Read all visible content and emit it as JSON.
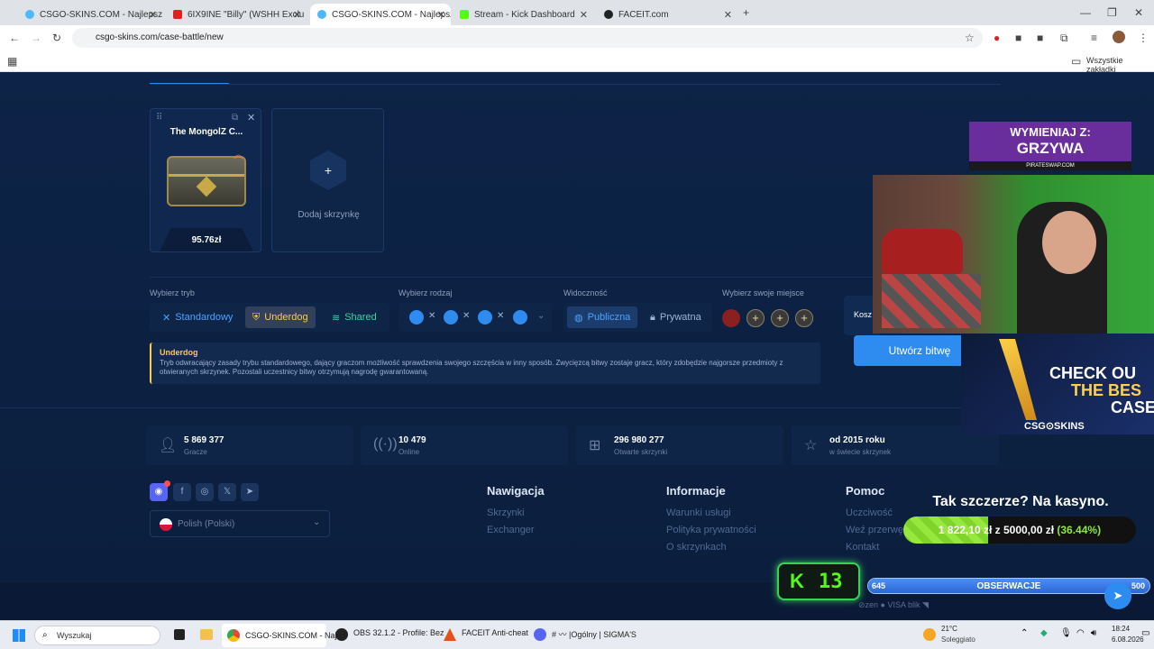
{
  "tabs": [
    {
      "title": "CSGO-SKINS.COM - Najlepsze"
    },
    {
      "title": "6IX9INE \"Billy\" (WSHH Exclu"
    },
    {
      "title": "CSGO-SKINS.COM - Najlepsze"
    },
    {
      "title": "Stream - Kick Dashboard"
    },
    {
      "title": "FACEIT.com"
    }
  ],
  "browser": {
    "url": "csgo-skins.com/case-battle/new",
    "bookmarks_label": "Wszystkie zakładki"
  },
  "case": {
    "name": "The MongolZ C...",
    "price": "95.76zł",
    "add_label": "Dodaj skrzynkę"
  },
  "mode": {
    "label": "Wybierz tryb",
    "options": [
      "Standardowy",
      "Underdog",
      "Shared"
    ],
    "selected": "Underdog"
  },
  "type": {
    "label": "Wybierz rodzaj"
  },
  "visibility": {
    "label": "Widoczność",
    "options": [
      "Publiczna",
      "Prywatna"
    ],
    "selected": "Publiczna"
  },
  "seat": {
    "label": "Wybierz swoje miejsce"
  },
  "cost": {
    "label": "Kosz"
  },
  "create_button": "Utwórz bitwę",
  "mode_info": {
    "title": "Underdog",
    "text": "Tryb odwracający zasady trybu standardowego, dający graczom możliwość sprawdzenia swojego szczęścia w inny sposób. Zwycięzcą bitwy zostaje gracz, który zdobędzie najgorsze przedmioty z otwieranych skrzynek. Pozostali uczestnicy bitwy otrzymują nagrodę gwarantowaną."
  },
  "stats": [
    {
      "value": "5 869 377",
      "sub": "Gracze",
      "icon": "user-icon"
    },
    {
      "value": "10 479",
      "sub": "Online",
      "icon": "signal-icon"
    },
    {
      "value": "296 980 277",
      "sub": "Otwarte skrzynki",
      "icon": "box-icon"
    },
    {
      "value": "od 2015 roku",
      "sub": "w świecie skrzynek",
      "icon": "star-icon"
    }
  ],
  "language": "Polish (Polski)",
  "footer": {
    "nav": {
      "title": "Nawigacja",
      "links": [
        "Skrzynki",
        "Exchanger"
      ]
    },
    "info": {
      "title": "Informacje",
      "links": [
        "Warunki usługi",
        "Polityka prywatności",
        "O skrzynkach"
      ]
    },
    "help": {
      "title": "Pomoc",
      "links": [
        "Uczciwość",
        "Weź przerwę",
        "Kontakt"
      ]
    }
  },
  "overlay": {
    "banner_top": "WYMIENIAJ Z:",
    "banner_name": "GRZYWA",
    "banner_sub": "PIRATESWAP.COM",
    "ad_line1": "CHECK OU",
    "ad_line2": "THE BES",
    "ad_line3": "CASE",
    "ad_brand": "CSG⊙SKINS",
    "casino_title": "Tak szczerze? Na kasyno.",
    "progress_current": "1 822,10 zł",
    "progress_of": "z",
    "progress_target": "5000,00 zł",
    "progress_pct": "(36.44%)",
    "progress_fraction": 0.3644,
    "kick_count": "13",
    "obs_left": "645",
    "obs_label": "OBSERWACJE",
    "obs_right": "500",
    "obs_fraction": 1.0
  },
  "taskbar": {
    "search": "Wyszukaj",
    "apps": [
      "CSGO-SKINS.COM - Naj",
      "OBS 32.1.2 - Profile: Bez",
      "FACEIT Anti-cheat",
      "# 〰 |Ogólny | SIGMA'S"
    ],
    "weather_temp": "21°C",
    "weather_desc": "Soleggiato",
    "time": "18:24",
    "date": "6.08.2026"
  },
  "colors": {
    "accent": "#2e8cf0",
    "gold": "#ffc94d",
    "green": "#8ee83a",
    "page_bg": "#0c1f3f"
  }
}
